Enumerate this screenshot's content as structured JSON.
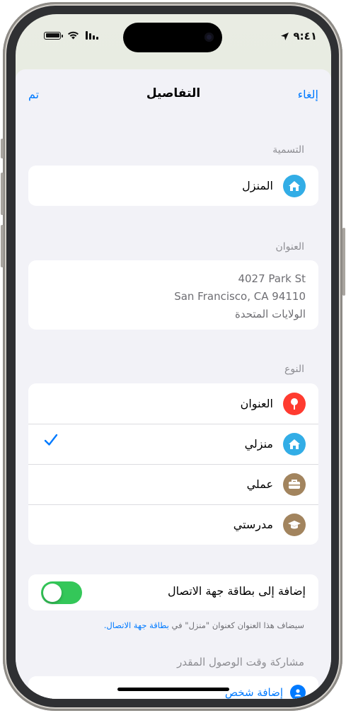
{
  "status_bar": {
    "time": "٩:٤١"
  },
  "nav": {
    "title": "التفاصيل",
    "cancel": "إلغاء",
    "done": "تم"
  },
  "label_section": {
    "header": "التسمية",
    "value": "المنزل",
    "icon": "house-icon",
    "icon_color": "#32ade6"
  },
  "address_section": {
    "header": "العنوان",
    "lines": [
      "4027 Park St",
      "San Francisco, CA  94110",
      "الولايات المتحدة"
    ]
  },
  "type_section": {
    "header": "النوع",
    "items": [
      {
        "label": "العنوان",
        "icon": "pin-icon",
        "color": "#ff3b30",
        "selected": false
      },
      {
        "label": "منزلي",
        "icon": "house-icon",
        "color": "#32ade6",
        "selected": true
      },
      {
        "label": "عملي",
        "icon": "briefcase-icon",
        "color": "#a2845e",
        "selected": false
      },
      {
        "label": "مدرستي",
        "icon": "graduation-cap-icon",
        "color": "#a2845e",
        "selected": false
      }
    ]
  },
  "contact_toggle": {
    "label": "إضافة إلى بطاقة جهة الاتصال",
    "on": true,
    "toggle_color": "#34c759"
  },
  "footnote": {
    "text": "سيضاف هذا العنوان كعنوان \"منزل\" في",
    "link": "بطاقة جهة الاتصال."
  },
  "eta_section": {
    "header": "مشاركة وقت الوصول المقدر",
    "add_person": "إضافة شخص"
  },
  "colors": {
    "accent": "#007aff",
    "sheet_bg": "#f2f2f7"
  }
}
